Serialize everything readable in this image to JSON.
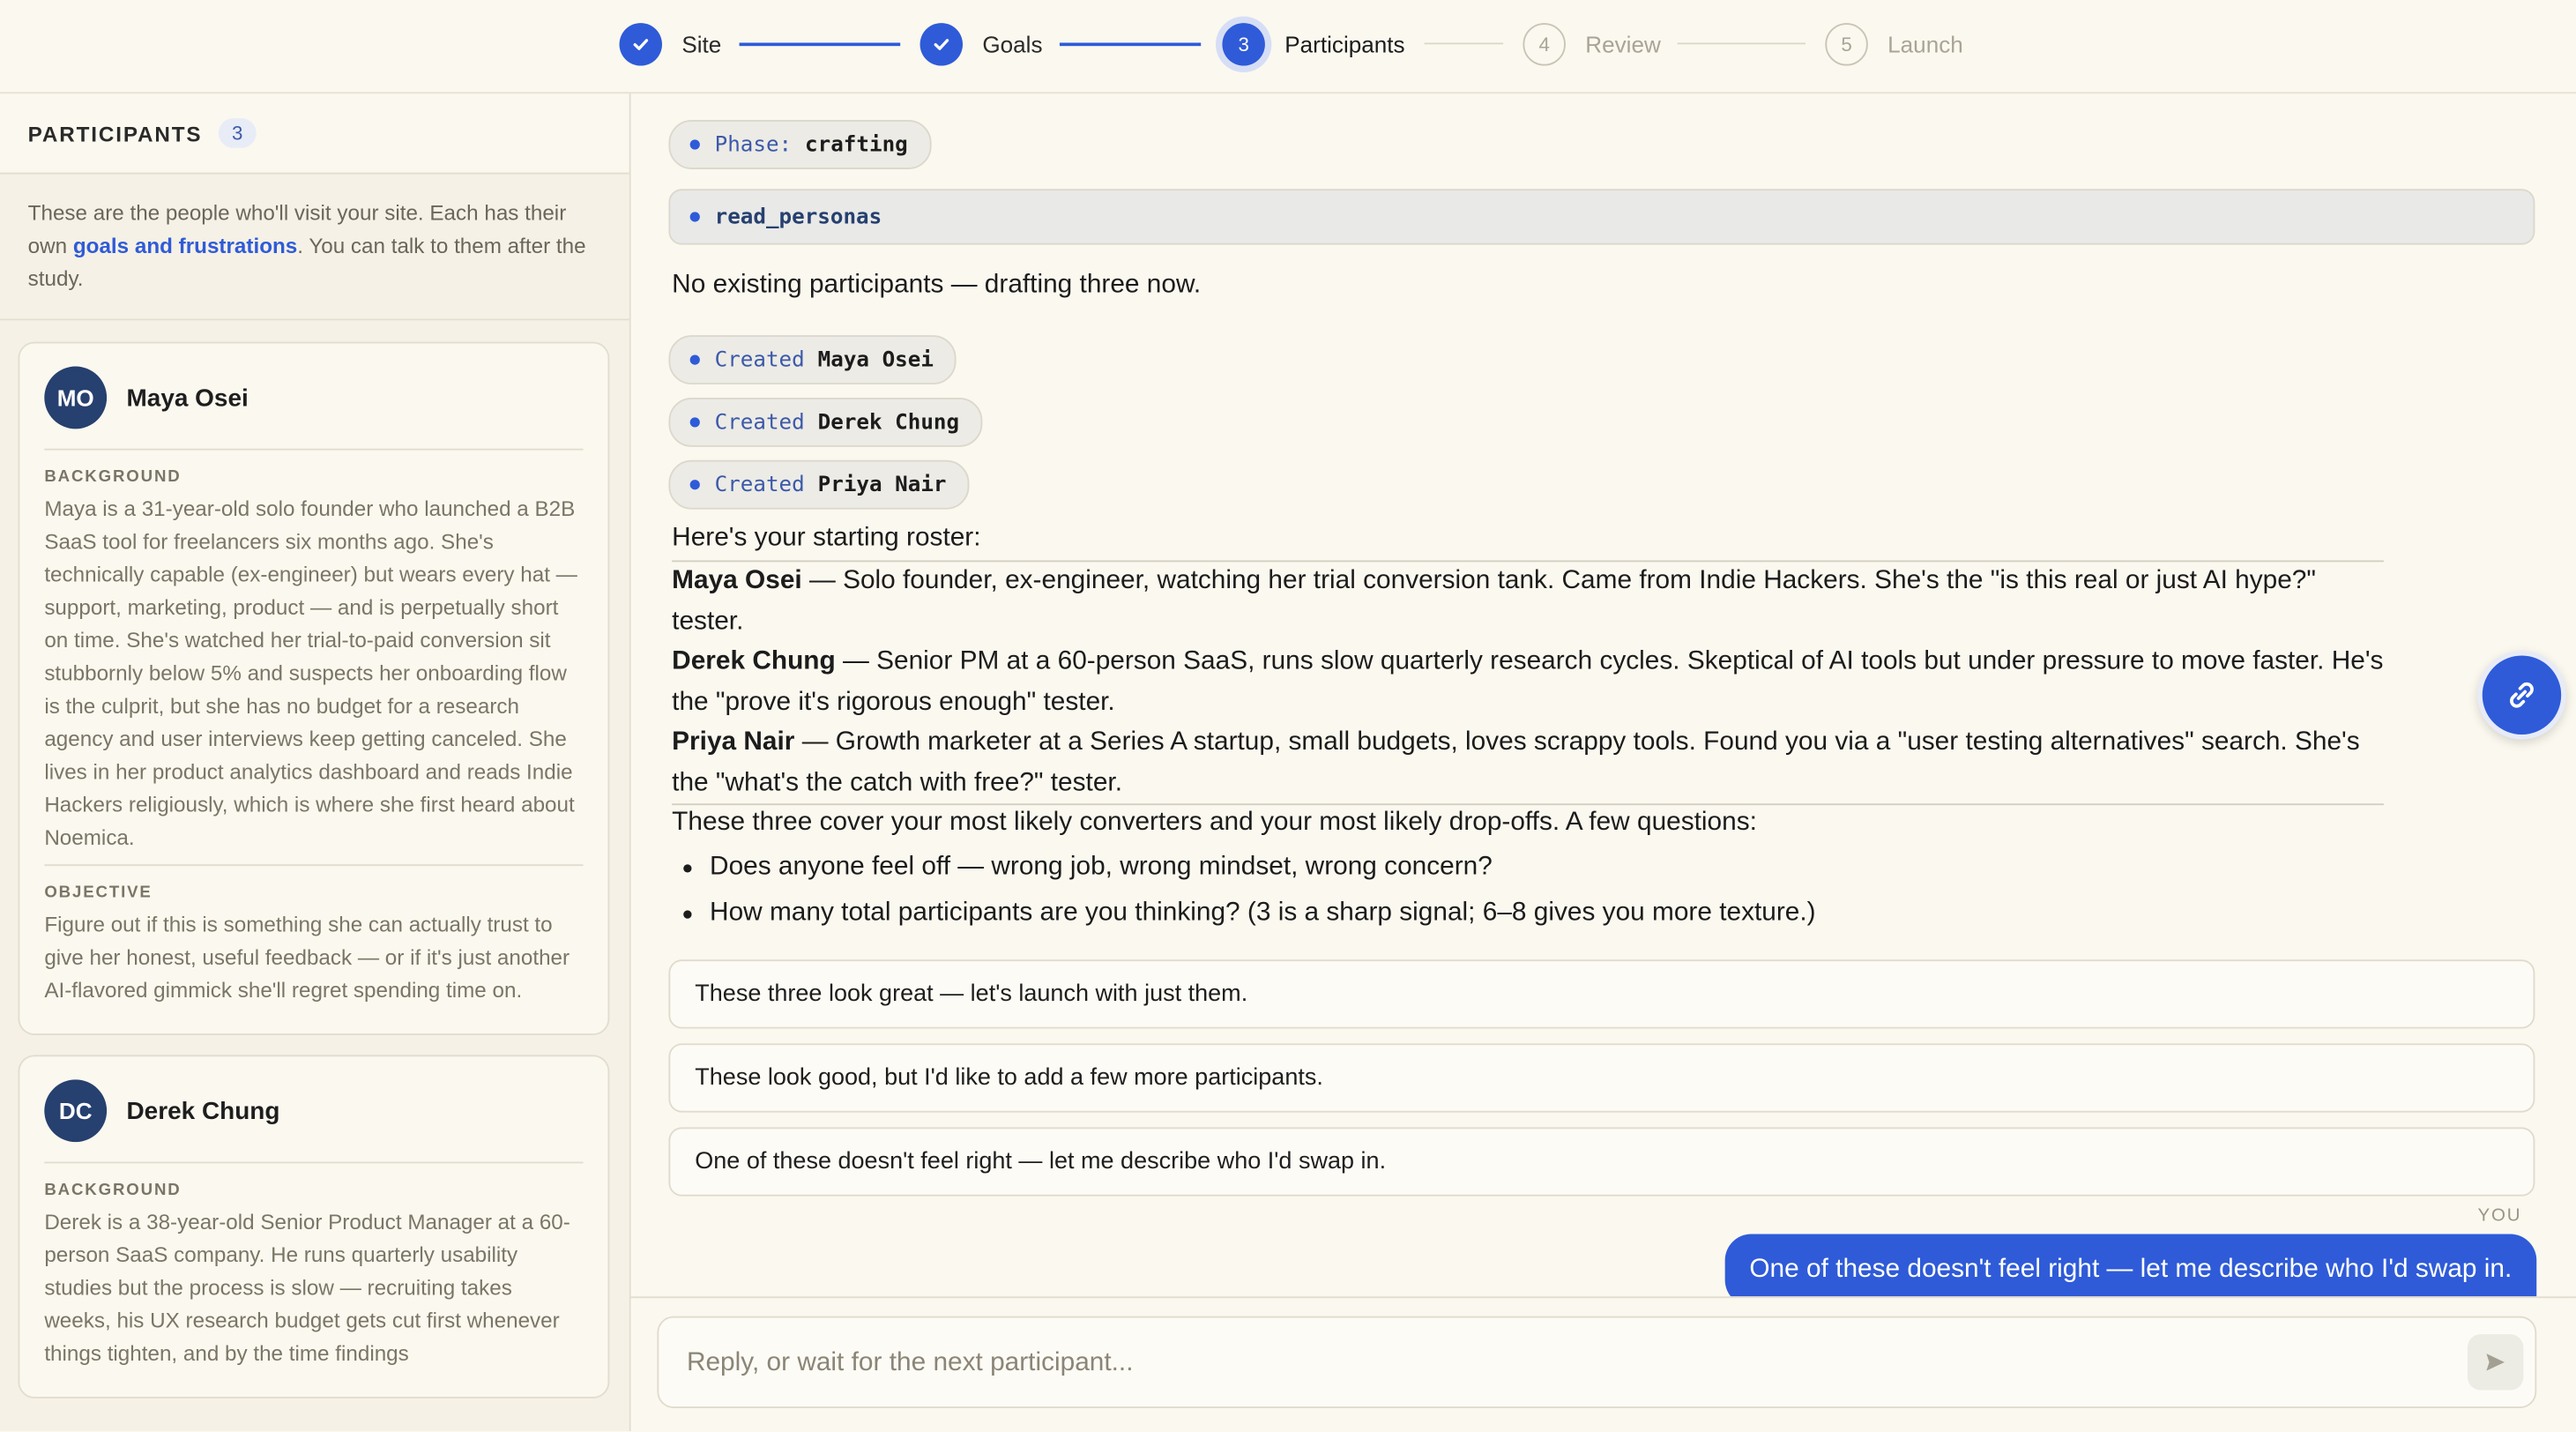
{
  "stepper": {
    "steps": [
      {
        "label": "Site",
        "number": "1",
        "state": "done"
      },
      {
        "label": "Goals",
        "number": "2",
        "state": "done"
      },
      {
        "label": "Participants",
        "number": "3",
        "state": "active"
      },
      {
        "label": "Review",
        "number": "4",
        "state": "todo"
      },
      {
        "label": "Launch",
        "number": "5",
        "state": "todo"
      }
    ]
  },
  "sidebar": {
    "title": "PARTICIPANTS",
    "count": "3",
    "intro_before": "These are the people who'll visit your site. Each has their own ",
    "intro_link": "goals and frustrations",
    "intro_after": ". You can talk to them after the study.",
    "participants": [
      {
        "initials": "MO",
        "name": "Maya Osei",
        "background_label": "BACKGROUND",
        "background": "Maya is a 31-year-old solo founder who launched a B2B SaaS tool for freelancers six months ago. She's technically capable (ex-engineer) but wears every hat — support, marketing, product — and is perpetually short on time. She's watched her trial-to-paid conversion sit stubbornly below 5% and suspects her onboarding flow is the culprit, but she has no budget for a research agency and user interviews keep getting canceled. She lives in her product analytics dashboard and reads Indie Hackers religiously, which is where she first heard about Noemica.",
        "objective_label": "OBJECTIVE",
        "objective": "Figure out if this is something she can actually trust to give her honest, useful feedback — or if it's just another AI-flavored gimmick she'll regret spending time on."
      },
      {
        "initials": "DC",
        "name": "Derek Chung",
        "background_label": "BACKGROUND",
        "background": "Derek is a 38-year-old Senior Product Manager at a 60-person SaaS company. He runs quarterly usability studies but the process is slow — recruiting takes weeks, his UX research budget gets cut first whenever things tighten, and by the time findings"
      }
    ]
  },
  "chat": {
    "phase_key": "Phase:",
    "phase_value": "crafting",
    "tool_name": "read_personas",
    "no_existing": "No existing participants — drafting three now.",
    "created_label": "Created",
    "created": [
      "Maya Osei",
      "Derek Chung",
      "Priya Nair"
    ],
    "roster_intro": "Here's your starting roster:",
    "roster": [
      {
        "name": "Maya Osei",
        "desc": " — Solo founder, ex-engineer, watching her trial conversion tank. Came from Indie Hackers. She's the \"is this real or just AI hype?\" tester."
      },
      {
        "name": "Derek Chung",
        "desc": " — Senior PM at a 60-person SaaS, runs slow quarterly research cycles. Skeptical of AI tools but under pressure to move faster. He's the \"prove it's rigorous enough\" tester."
      },
      {
        "name": "Priya Nair",
        "desc": " — Growth marketer at a Series A startup, small budgets, loves scrappy tools. Found you via a \"user testing alternatives\" search. She's the \"what's the catch with free?\" tester."
      }
    ],
    "summary": "These three cover your most likely converters and your most likely drop-offs. A few questions:",
    "questions": [
      "Does anyone feel off — wrong job, wrong mindset, wrong concern?",
      "How many total participants are you thinking? (3 is a sharp signal; 6–8 gives you more texture.)"
    ],
    "options": [
      "These three look great — let's launch with just them.",
      "These look good, but I'd like to add a few more participants.",
      "One of these doesn't feel right — let me describe who I'd swap in."
    ],
    "you_label": "YOU",
    "user_message": "One of these doesn't feel right — let me describe who I'd swap in."
  },
  "composer": {
    "placeholder": "Reply, or wait for the next participant..."
  },
  "colors": {
    "accent": "#2f5bd8",
    "background": "#fbf8ef",
    "avatar": "#26406f"
  }
}
